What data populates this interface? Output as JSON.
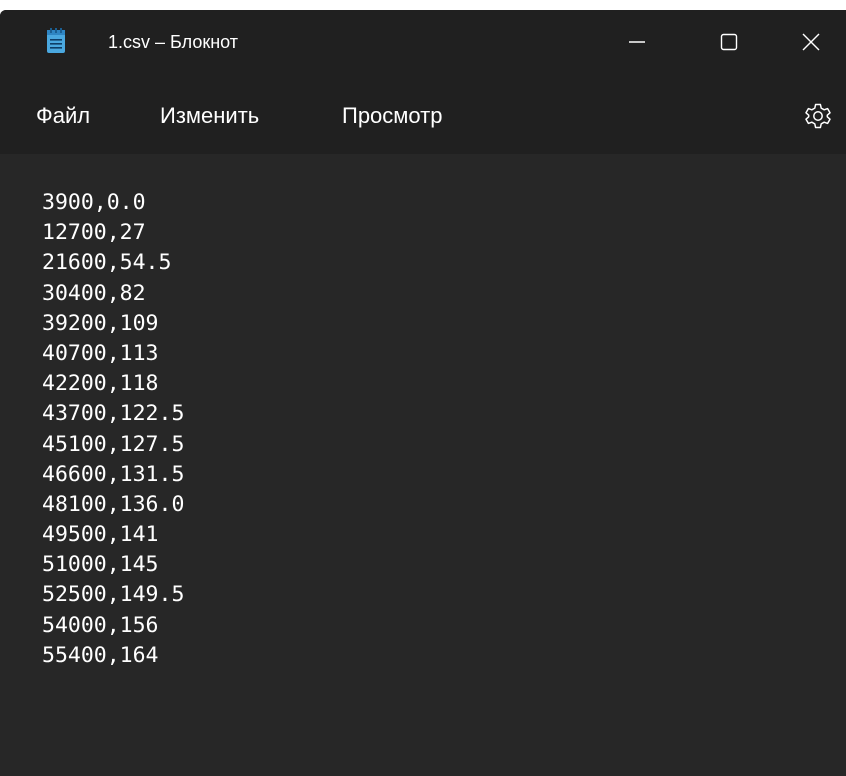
{
  "window": {
    "title": "1.csv – Блокнот",
    "icons": {
      "app": "notepad-icon",
      "minimize": "minimize-icon",
      "maximize": "maximize-icon",
      "close": "close-icon",
      "settings": "gear-icon"
    },
    "colors": {
      "titlebar": "#202020",
      "editor": "#272727",
      "text": "#ffffff",
      "app_icon": "#4aa8e0"
    }
  },
  "menu": {
    "file": "Файл",
    "edit": "Изменить",
    "view": "Просмотр"
  },
  "content": {
    "lines": [
      "3900,0.0",
      "12700,27",
      "21600,54.5",
      "30400,82",
      "39200,109",
      "40700,113",
      "42200,118",
      "43700,122.5",
      "45100,127.5",
      "46600,131.5",
      "48100,136.0",
      "49500,141",
      "51000,145",
      "52500,149.5",
      "54000,156",
      "55400,164"
    ]
  }
}
